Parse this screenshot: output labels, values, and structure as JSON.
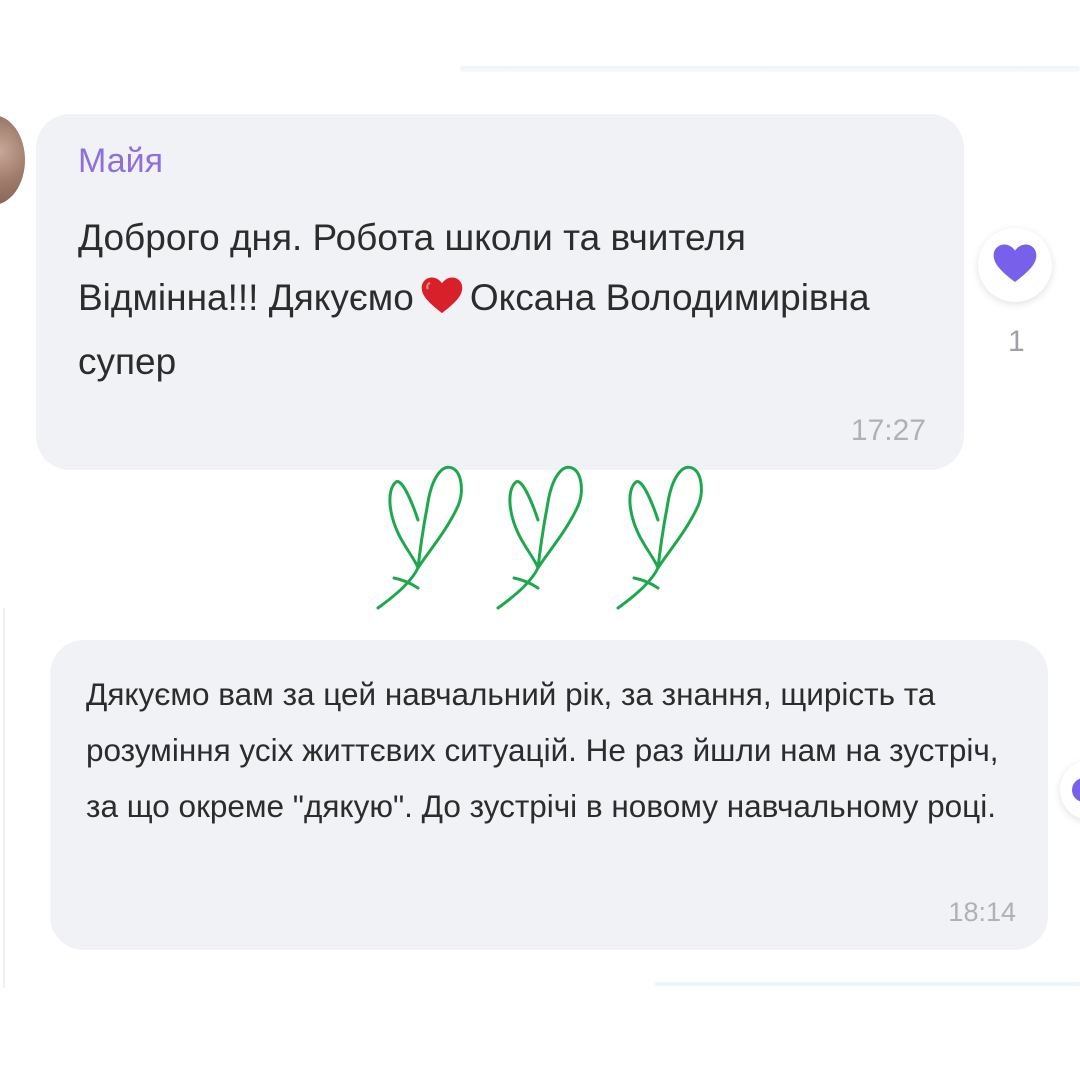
{
  "message1": {
    "sender": "Майя",
    "text_before_emoji": "Доброго дня. Робота школи та вчителя Відмінна!!! Дякуємо",
    "text_after_emoji": "Оксана Володимирівна супер",
    "emoji_icon": "red-heart-icon",
    "time": "17:27",
    "reaction": {
      "icon": "purple-heart-icon",
      "count": "1"
    }
  },
  "message2": {
    "text": "Дякуємо вам за цей навчальний рік, за знання, щирість та розуміння усіх життєвих ситуацій. Не раз йшли нам на зустріч, за що окреме \"дякую\". До зустрічі в новому навчальному році.",
    "time": "18:14"
  },
  "decoration": {
    "icon": "green-hearts-doodle",
    "count": 3
  },
  "colors": {
    "sender": "#8f6fdc",
    "bubble": "#f1f2f6",
    "reaction_heart": "#7860ea",
    "emoji_heart": "#d8202a",
    "doodle_hearts": "#1ea84e"
  }
}
